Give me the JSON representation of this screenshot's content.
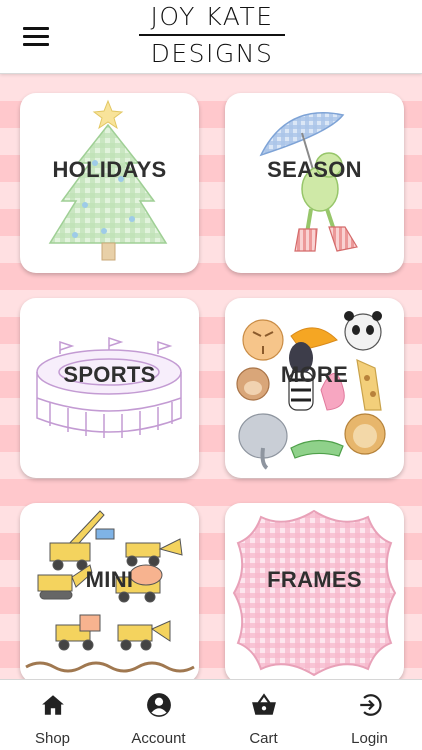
{
  "header": {
    "logo_line1": "JOY KATE",
    "logo_line2": "DESIGNS",
    "menu_icon": "hamburger-menu-icon"
  },
  "categories": [
    {
      "label": "HOLIDAYS",
      "art": "christmas-tree-illustration"
    },
    {
      "label": "SEASON",
      "art": "frog-umbrella-illustration"
    },
    {
      "label": "SPORTS",
      "art": "stadium-illustration"
    },
    {
      "label": "MORE",
      "art": "animals-illustration"
    },
    {
      "label": "MINI",
      "art": "construction-vehicles-illustration"
    },
    {
      "label": "FRAMES",
      "art": "gingham-frame-illustration"
    }
  ],
  "tabs": [
    {
      "label": "Shop",
      "icon": "home-icon"
    },
    {
      "label": "Account",
      "icon": "account-icon"
    },
    {
      "label": "Cart",
      "icon": "basket-icon"
    },
    {
      "label": "Login",
      "icon": "login-icon"
    }
  ],
  "colors": {
    "stripe_light": "#ffe0e2",
    "stripe_dark": "#ffc8cc",
    "label": "#2f2f2f",
    "tab_icon": "#222222"
  }
}
